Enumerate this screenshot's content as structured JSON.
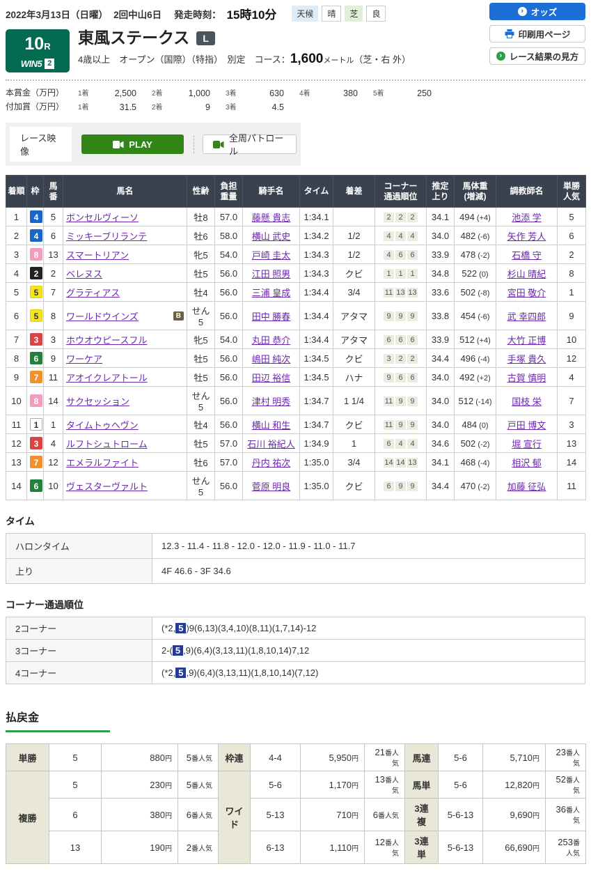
{
  "colors": {
    "accent_green": "#046a52",
    "odds_button_blue": "#1c6fd4",
    "play_green": "#338517",
    "table_header_dark": "#39424e",
    "link_purple": "#6b28ae",
    "payout_underline_green": "#2f9e44",
    "corner_mark_blue": "#253c92"
  },
  "header": {
    "date": "2022年3月13日（日曜）",
    "meeting": "2回中山6日",
    "start_label": "発走時刻：",
    "start_time": "15時10分",
    "weather_label": "天候",
    "weather_value": "晴",
    "turf_label": "芝",
    "turf_value": "良",
    "buttons": {
      "odds": "オッズ",
      "odds_icon": "›",
      "print": "印刷用ページ",
      "guide": "レース結果の見方",
      "guide_icon": "›"
    }
  },
  "race": {
    "number": "10",
    "number_suffix": "R",
    "win5": "WIN5",
    "win5_num": "2",
    "title": "東風ステークス",
    "grade": "L",
    "conditions": "4歳以上　オープン（国際）（特指）　別定　コース：",
    "distance": "1,600",
    "distance_unit": "メートル",
    "course_note": "（芝・右 外）"
  },
  "prize": {
    "main_label": "本賞金（万円）",
    "main": [
      [
        "1着",
        "2,500"
      ],
      [
        "2着",
        "1,000"
      ],
      [
        "3着",
        "630"
      ],
      [
        "4着",
        "380"
      ],
      [
        "5着",
        "250"
      ]
    ],
    "added_label": "付加賞（万円）",
    "added": [
      [
        "1着",
        "31.5"
      ],
      [
        "2着",
        "9"
      ],
      [
        "3着",
        "4.5"
      ]
    ]
  },
  "video": {
    "label": "レース映像",
    "play": "PLAY",
    "patrol": "全周パトロール"
  },
  "results": {
    "headers": [
      [
        "着順"
      ],
      [
        "枠"
      ],
      [
        "馬",
        "番"
      ],
      [
        "馬名"
      ],
      [
        "性齢"
      ],
      [
        "負担",
        "重量"
      ],
      [
        "騎手名"
      ],
      [
        "タイム"
      ],
      [
        "着差"
      ],
      [
        "コーナー",
        "通過順位"
      ],
      [
        "推定",
        "上り"
      ],
      [
        "馬体重",
        "(増減)"
      ],
      [
        "調教師名"
      ],
      [
        "単勝",
        "人気"
      ]
    ],
    "frame_colors": {
      "1": {
        "bg": "#ffffff",
        "fg": "#333333",
        "bd": "#aaaaaa"
      },
      "2": {
        "bg": "#222222",
        "fg": "#ffffff",
        "bd": "#222222"
      },
      "3": {
        "bg": "#d94343",
        "fg": "#ffffff",
        "bd": "#d94343"
      },
      "4": {
        "bg": "#1966c8",
        "fg": "#ffffff",
        "bd": "#1966c8"
      },
      "5": {
        "bg": "#f2e423",
        "fg": "#333333",
        "bd": "#ddd012"
      },
      "6": {
        "bg": "#23803d",
        "fg": "#ffffff",
        "bd": "#23803d"
      },
      "7": {
        "bg": "#f0912c",
        "fg": "#ffffff",
        "bd": "#f0912c"
      },
      "8": {
        "bg": "#f29cc0",
        "fg": "#ffffff",
        "bd": "#f29cc0"
      }
    },
    "rows": [
      {
        "pos": "1",
        "frame": "4",
        "num": "5",
        "name": "ボンセルヴィーソ",
        "b": "",
        "sexage": "牡8",
        "load": "57.0",
        "jockey": "藤懸 貴志",
        "time": "1:34.1",
        "margin": "",
        "corners": [
          "2",
          "2",
          "2"
        ],
        "agari": "34.1",
        "weight": "494",
        "wdiff": "(+4)",
        "trainer": "池添 学",
        "fav": "5"
      },
      {
        "pos": "2",
        "frame": "4",
        "num": "6",
        "name": "ミッキーブリランテ",
        "b": "",
        "sexage": "牡6",
        "load": "58.0",
        "jockey": "横山 武史",
        "time": "1:34.2",
        "margin": "1/2",
        "corners": [
          "4",
          "4",
          "4"
        ],
        "agari": "34.0",
        "weight": "482",
        "wdiff": "(-6)",
        "trainer": "矢作 芳人",
        "fav": "6"
      },
      {
        "pos": "3",
        "frame": "8",
        "num": "13",
        "name": "スマートリアン",
        "b": "",
        "sexage": "牝5",
        "load": "54.0",
        "jockey": "戸崎 圭太",
        "time": "1:34.3",
        "margin": "1/2",
        "corners": [
          "4",
          "6",
          "6"
        ],
        "agari": "33.9",
        "weight": "478",
        "wdiff": "(-2)",
        "trainer": "石橋 守",
        "fav": "2"
      },
      {
        "pos": "4",
        "frame": "2",
        "num": "2",
        "name": "ベレヌス",
        "b": "",
        "sexage": "牡5",
        "load": "56.0",
        "jockey": "江田 照男",
        "time": "1:34.3",
        "margin": "クビ",
        "corners": [
          "1",
          "1",
          "1"
        ],
        "agari": "34.8",
        "weight": "522",
        "wdiff": "(0)",
        "trainer": "杉山 晴紀",
        "fav": "8"
      },
      {
        "pos": "5",
        "frame": "5",
        "num": "7",
        "name": "グラティアス",
        "b": "",
        "sexage": "牡4",
        "load": "56.0",
        "jockey": "三浦 皇成",
        "time": "1:34.4",
        "margin": "3/4",
        "corners": [
          "11",
          "13",
          "13"
        ],
        "agari": "33.6",
        "weight": "502",
        "wdiff": "(-8)",
        "trainer": "宮田 敬介",
        "fav": "1"
      },
      {
        "pos": "6",
        "frame": "5",
        "num": "8",
        "name": "ワールドウインズ",
        "b": "B",
        "sexage": "せん5",
        "load": "56.0",
        "jockey": "田中 勝春",
        "time": "1:34.4",
        "margin": "アタマ",
        "corners": [
          "9",
          "9",
          "9"
        ],
        "agari": "33.8",
        "weight": "454",
        "wdiff": "(-6)",
        "trainer": "武 幸四郎",
        "fav": "9"
      },
      {
        "pos": "7",
        "frame": "3",
        "num": "3",
        "name": "ホウオウピースフル",
        "b": "",
        "sexage": "牝5",
        "load": "54.0",
        "jockey": "丸田 恭介",
        "time": "1:34.4",
        "margin": "アタマ",
        "corners": [
          "6",
          "6",
          "6"
        ],
        "agari": "33.9",
        "weight": "512",
        "wdiff": "(+4)",
        "trainer": "大竹 正博",
        "fav": "10"
      },
      {
        "pos": "8",
        "frame": "6",
        "num": "9",
        "name": "ワーケア",
        "b": "",
        "sexage": "牡5",
        "load": "56.0",
        "jockey": "嶋田 純次",
        "time": "1:34.5",
        "margin": "クビ",
        "corners": [
          "3",
          "2",
          "2"
        ],
        "agari": "34.4",
        "weight": "496",
        "wdiff": "(-4)",
        "trainer": "手塚 貴久",
        "fav": "12"
      },
      {
        "pos": "9",
        "frame": "7",
        "num": "11",
        "name": "アオイクレアトール",
        "b": "",
        "sexage": "牡5",
        "load": "56.0",
        "jockey": "田辺 裕信",
        "time": "1:34.5",
        "margin": "ハナ",
        "corners": [
          "9",
          "6",
          "6"
        ],
        "agari": "34.0",
        "weight": "492",
        "wdiff": "(+2)",
        "trainer": "古賀 慎明",
        "fav": "4"
      },
      {
        "pos": "10",
        "frame": "8",
        "num": "14",
        "name": "サクセッション",
        "b": "",
        "sexage": "せん5",
        "load": "56.0",
        "jockey": "津村 明秀",
        "time": "1:34.7",
        "margin": "1 1/4",
        "corners": [
          "11",
          "9",
          "9"
        ],
        "agari": "34.0",
        "weight": "512",
        "wdiff": "(-14)",
        "trainer": "国枝 栄",
        "fav": "7"
      },
      {
        "pos": "11",
        "frame": "1",
        "num": "1",
        "name": "タイムトゥヘヴン",
        "b": "",
        "sexage": "牡4",
        "load": "56.0",
        "jockey": "横山 和生",
        "time": "1:34.7",
        "margin": "クビ",
        "corners": [
          "11",
          "9",
          "9"
        ],
        "agari": "34.0",
        "weight": "484",
        "wdiff": "(0)",
        "trainer": "戸田 博文",
        "fav": "3"
      },
      {
        "pos": "12",
        "frame": "3",
        "num": "4",
        "name": "ルフトシュトローム",
        "b": "",
        "sexage": "牡5",
        "load": "57.0",
        "jockey": "石川 裕紀人",
        "time": "1:34.9",
        "margin": "1",
        "corners": [
          "6",
          "4",
          "4"
        ],
        "agari": "34.6",
        "weight": "502",
        "wdiff": "(-2)",
        "trainer": "堀 宣行",
        "fav": "13"
      },
      {
        "pos": "13",
        "frame": "7",
        "num": "12",
        "name": "エメラルファイト",
        "b": "",
        "sexage": "牡6",
        "load": "57.0",
        "jockey": "丹内 祐次",
        "time": "1:35.0",
        "margin": "3/4",
        "corners": [
          "14",
          "14",
          "13"
        ],
        "agari": "34.1",
        "weight": "468",
        "wdiff": "(-4)",
        "trainer": "相沢 郁",
        "fav": "14"
      },
      {
        "pos": "14",
        "frame": "6",
        "num": "10",
        "name": "ヴェスターヴァルト",
        "b": "",
        "sexage": "せん5",
        "load": "56.0",
        "jockey": "菅原 明良",
        "time": "1:35.0",
        "margin": "クビ",
        "corners": [
          "6",
          "9",
          "9"
        ],
        "agari": "34.4",
        "weight": "470",
        "wdiff": "(-2)",
        "trainer": "加藤 征弘",
        "fav": "11"
      }
    ]
  },
  "time_section": {
    "title": "タイム",
    "rows": [
      {
        "label": "ハロンタイム",
        "value": "12.3 - 11.4 - 11.8 - 12.0 - 12.0 - 11.9 - 11.0 - 11.7"
      },
      {
        "label": "上り",
        "value": "4F 46.6 - 3F 34.6"
      }
    ]
  },
  "corner_section": {
    "title": "コーナー通過順位",
    "rows": [
      {
        "label": "2コーナー",
        "pre": "(*2,",
        "mark": "5",
        "post": ")9(6,13)(3,4,10)(8,11)(1,7,14)-12"
      },
      {
        "label": "3コーナー",
        "pre": "2-(",
        "mark": "5",
        "post": ",9)(6,4)(3,13,11)(1,8,10,14)7,12"
      },
      {
        "label": "4コーナー",
        "pre": "(*2,",
        "mark": "5",
        "post": ",9)(6,4)(3,13,11)(1,8,10,14)(7,12)"
      }
    ]
  },
  "payout": {
    "title": "払戻金",
    "yen_suffix": "円",
    "pop_suffix": "番人気",
    "groups": [
      {
        "rows": [
          {
            "label": "単勝",
            "span": 1,
            "combo": "5",
            "amount": "880",
            "pop": "5"
          },
          {
            "label": "複勝",
            "span": 3,
            "combo": "5",
            "amount": "230",
            "pop": "5"
          },
          {
            "cont": true,
            "combo": "6",
            "amount": "380",
            "pop": "6"
          },
          {
            "cont": true,
            "combo": "13",
            "amount": "190",
            "pop": "2"
          }
        ]
      },
      {
        "rows": [
          {
            "label": "枠連",
            "span": 1,
            "combo": "4-4",
            "amount": "5,950",
            "pop": "21"
          },
          {
            "label": "ワイド",
            "span": 3,
            "combo": "5-6",
            "amount": "1,170",
            "pop": "13"
          },
          {
            "cont": true,
            "combo": "5-13",
            "amount": "710",
            "pop": "6"
          },
          {
            "cont": true,
            "combo": "6-13",
            "amount": "1,110",
            "pop": "12"
          }
        ]
      },
      {
        "rows": [
          {
            "label": "馬連",
            "span": 1,
            "combo": "5-6",
            "amount": "5,710",
            "pop": "23"
          },
          {
            "label": "馬単",
            "span": 1,
            "combo": "5-6",
            "amount": "12,820",
            "pop": "52"
          },
          {
            "label": "3連複",
            "span": 1,
            "combo": "5-6-13",
            "amount": "9,690",
            "pop": "36"
          },
          {
            "label": "3連単",
            "span": 1,
            "combo": "5-6-13",
            "amount": "66,690",
            "pop": "253"
          }
        ]
      }
    ]
  }
}
